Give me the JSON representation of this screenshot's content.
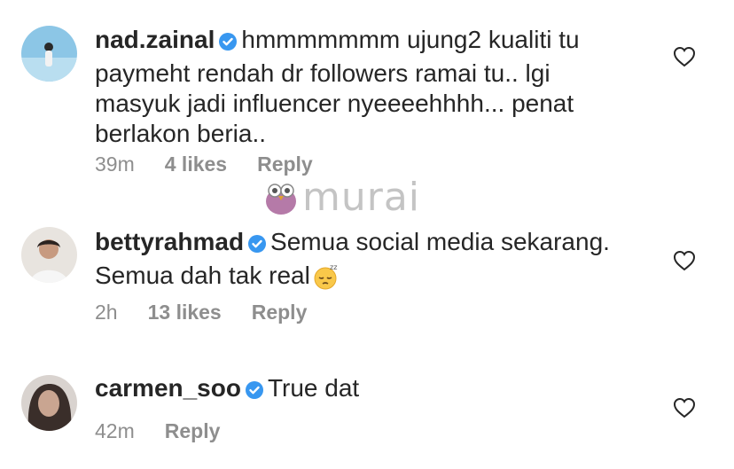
{
  "comments": [
    {
      "username": "nad.zainal",
      "text": "hmmmmmmm ujung2 kualiti tu paymeht rendah dr followers ramai tu.. lgi masyuk jadi influencer nyeeeehhhh... penat berlakon beria..",
      "time": "39m",
      "likes": "4 likes",
      "reply": "Reply"
    },
    {
      "username": "bettyrahmad",
      "text": "Semua social media sekarang. Semua dah tak real",
      "emoji": "sleepy-face-emoji",
      "time": "2h",
      "likes": "13 likes",
      "reply": "Reply"
    },
    {
      "username": "carmen_soo",
      "text": "True dat",
      "time": "42m",
      "reply": "Reply"
    }
  ],
  "watermark": {
    "text": "murai"
  },
  "colors": {
    "verified": "#3897f0",
    "meta": "#8e8e8e",
    "text": "#262626"
  }
}
